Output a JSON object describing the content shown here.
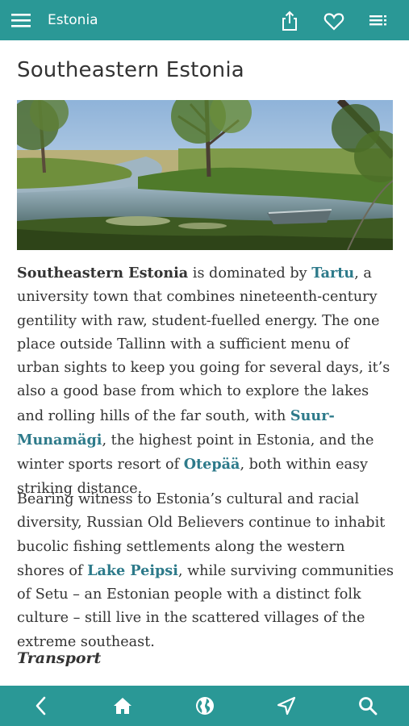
{
  "header": {
    "title": "Estonia",
    "icons": [
      "menu-icon",
      "share-icon",
      "heart-icon",
      "list-icon"
    ]
  },
  "article": {
    "heading": "Southeastern Estonia",
    "image_alt": "Reed-fringed river with a rowing boat under trees",
    "p1": {
      "strong": "Southeastern Estonia",
      "t1": " is dominated by ",
      "link1": "Tartu",
      "t2": ", a university town that combines nineteenth-century gentility with raw, student-fuelled energy. The one place outside Tallinn with a sufficient menu of urban sights to keep you going for several days, it’s also a good base from which to explore the lakes and rolling hills of the far south, with ",
      "link2": "Suur-Munamägi",
      "t3": ", the highest point in Estonia, and the winter sports resort of ",
      "link3": "Otepää",
      "t4": ", both within easy striking distance."
    },
    "p2": {
      "t1": "Bearing witness to Estonia’s cultural and racial diversity, Russian Old Believers continue to inhabit bucolic fishing settlements along the western shores of ",
      "link1": "Lake Peipsi",
      "t2": ", while surviving communities of Setu – an Estonian people with a distinct folk culture – still live in the scattered villages of the extreme southeast."
    },
    "section": "Transport"
  },
  "footer": {
    "icons": [
      "back-icon",
      "home-icon",
      "globe-icon",
      "navigate-icon",
      "search-icon"
    ]
  },
  "colors": {
    "bar": "#2a9896",
    "link": "#2d7a8a",
    "text": "#333333"
  }
}
